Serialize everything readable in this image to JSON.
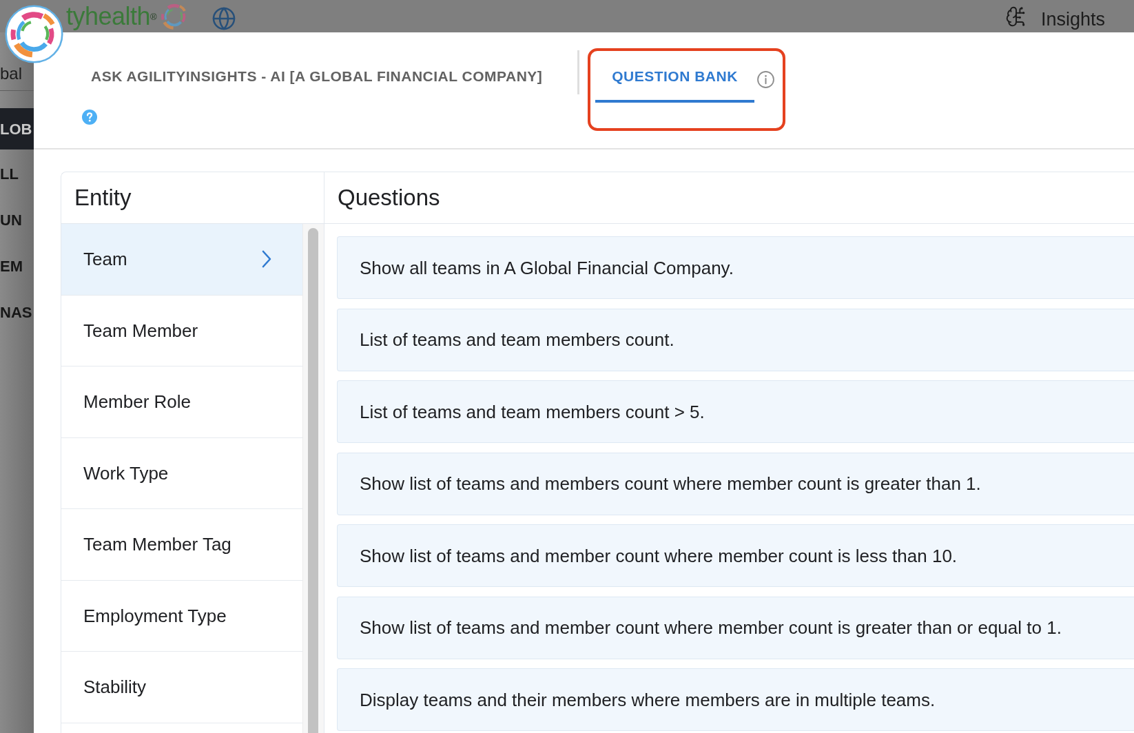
{
  "background": {
    "brand": "tyhealth$^{®}$",
    "menu_label": "Insights",
    "side_fragments": [
      {
        "text": "bal",
        "kind": "plain"
      },
      {
        "text": "LOB",
        "kind": "active"
      },
      {
        "text": "LL",
        "kind": "bold"
      },
      {
        "text": "UN",
        "kind": "bold"
      },
      {
        "text": "EM",
        "kind": "bold"
      },
      {
        "text": "NAS",
        "kind": "bold"
      }
    ]
  },
  "dialog": {
    "tabs": [
      {
        "label": "ASK AGILITYINSIGHTS - AI [A GLOBAL FINANCIAL COMPANY]",
        "selected": false,
        "highlighted": false
      },
      {
        "label": "QUESTION BANK",
        "selected": true,
        "highlighted": true
      }
    ],
    "entity": {
      "heading": "Entity",
      "items": [
        {
          "label": "Team",
          "selected": true
        },
        {
          "label": "Team Member",
          "selected": false
        },
        {
          "label": "Member Role",
          "selected": false
        },
        {
          "label": "Work Type",
          "selected": false
        },
        {
          "label": "Team Member Tag",
          "selected": false
        },
        {
          "label": "Employment Type",
          "selected": false
        },
        {
          "label": "Stability",
          "selected": false
        }
      ]
    },
    "questions": {
      "heading": "Questions",
      "items": [
        "Show all teams in A Global Financial Company.",
        "List of teams and team members count.",
        "List of teams and team members count > 5.",
        "Show list of teams and members count where member count is greater than 1.",
        "Show list of teams and member count where member count is less than 10.",
        "Show list of teams and member count where member count is greater than or equal to 1.",
        "Display teams and their members where members are in multiple teams."
      ]
    }
  }
}
